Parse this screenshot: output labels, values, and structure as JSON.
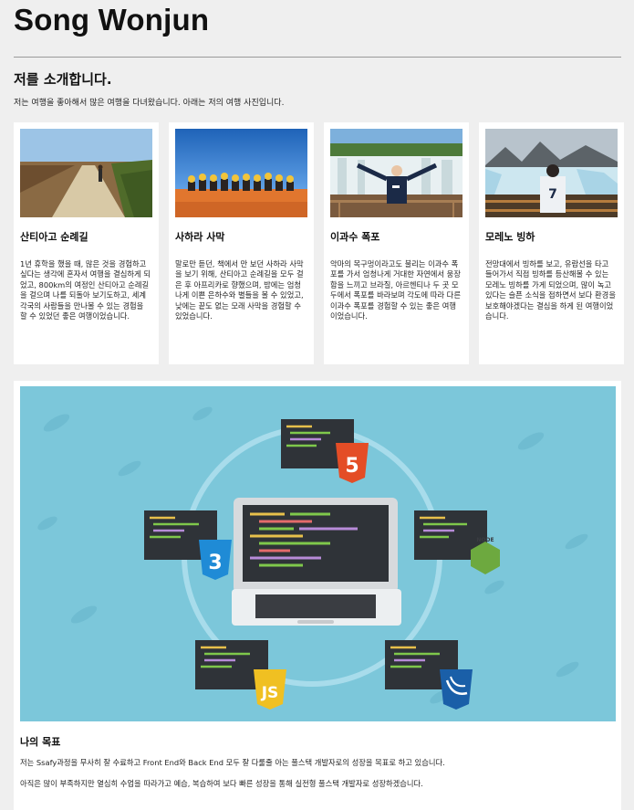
{
  "header": {
    "title": "Song Wonjun"
  },
  "intro": {
    "heading": "저를 소개합니다.",
    "text": "저는 여행을 좋아해서 많은 여행을 다녀왔습니다. 아래는 저의 여행 사진입니다."
  },
  "cards": [
    {
      "title": "산티아고 순례길",
      "text": "1년 휴학을 했을 때, 많은 것을 경험하고 싶다는 생각에 혼자서 여행을 결심하게 되었고, 800km의 여정인 산티아고 순례길을 걸으며 나를 되돌아 보기도하고, 세계 각국의 사람들을 만나볼 수 있는 경험을 할 수 있었던 좋은 여행이었습니다."
    },
    {
      "title": "사하라 사막",
      "text": "말로만 듣던, 책에서 만 보던 사하라 사막을 보기 위해, 산티아고 순례길을 모두 걸은 후 아프리카로 향했으며, 밤에는 엄청나게 이쁜 은하수와 별들을 볼 수 있었고, 낮에는 끝도 없는 모래 사막을 경험할 수 있었습니다."
    },
    {
      "title": "이과수 폭포",
      "text": "악마의 목구멍이라고도 불리는 이과수 폭포를 가서 엄청나게 거대한 자연에서 웅장함을 느끼고 브라질, 아르헨티나 두 곳 모두에서 폭포를 바라보며 각도에 따라 다른 이과수 폭포를 경험할 수 있는 좋은 여행이었습니다."
    },
    {
      "title": "모레노 빙하",
      "text": "전망대에서 빙하를 보고, 유람선을 타고 들어가서 직접 빙하를 등산해볼 수 있는 모레노 빙하를 가게 되었으며, 많이 녹고 있다는 슬픈 소식을 접하면서 보다 환경을 보호해야겠다는 결심을 하게 된 여행이었습니다."
    }
  ],
  "goal": {
    "title": "나의 목표",
    "line1": "저는 Ssafy과정을 무사히 잘 수료하고 Front End와 Back End 모두 잘 다룰줄 아는 풀스택 개발자로의 성장을 목표로 하고 있습니다.",
    "line2": "아직은 많이 부족하지만 열심히 수업을 따라가고 예습, 복습하여 보다 빠른 성장을 통해 실전형 풀스택 개발자로 성장하겠습니다.",
    "badges": {
      "html": "5",
      "css": "3",
      "js": "JS",
      "node": "NODE"
    }
  },
  "colors": {
    "banner": "#7cc7da",
    "html": "#e44d26",
    "css": "#1f8bd6",
    "js": "#f0c022",
    "node": "#6da93f",
    "jquery": "#1a5fa8"
  }
}
